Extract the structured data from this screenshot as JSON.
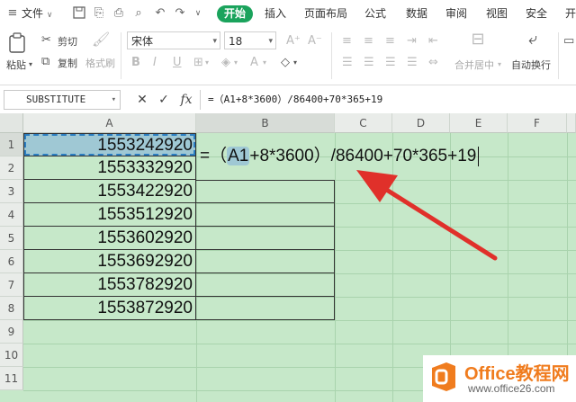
{
  "menu": {
    "file_label": "文件",
    "tabs": [
      "开始",
      "插入",
      "页面布局",
      "公式",
      "数据",
      "审阅",
      "视图",
      "安全",
      "开"
    ],
    "active_tab": "开始"
  },
  "ribbon": {
    "paste_label": "粘贴",
    "cut_label": "剪切",
    "copy_label": "复制",
    "format_painter_label": "格式刷",
    "font_name": "宋体",
    "font_size": "18",
    "merge_label": "合并居中",
    "wrap_label": "自动换行"
  },
  "formula_bar": {
    "name_box": "SUBSTITUTE",
    "cancel_symbol": "✕",
    "confirm_symbol": "✓",
    "fx_label": "fx",
    "formula": "=（A1+8*3600）/86400+70*365+19"
  },
  "sheet": {
    "columns": [
      "A",
      "B",
      "C",
      "D",
      "E",
      "F"
    ],
    "rows": [
      "1",
      "2",
      "3",
      "4",
      "5",
      "6",
      "7",
      "8",
      "9",
      "10",
      "11"
    ],
    "column_a_values": [
      "1553242920",
      "1553332920",
      "1553422920",
      "1553512920",
      "1553602920",
      "1553692920",
      "1553782920",
      "1553872920"
    ],
    "edit": {
      "prefix": "=（",
      "ref": "A1",
      "suffix": "+8*3600）/86400+70*365+19"
    }
  },
  "watermark": {
    "brand": "Office教程网",
    "url": "www.office26.com"
  },
  "colors": {
    "accent": "#1aa35c",
    "sheet_background": "#c6e8c9",
    "arrow": "#e0302a",
    "logo_orange": "#f07c1e"
  }
}
